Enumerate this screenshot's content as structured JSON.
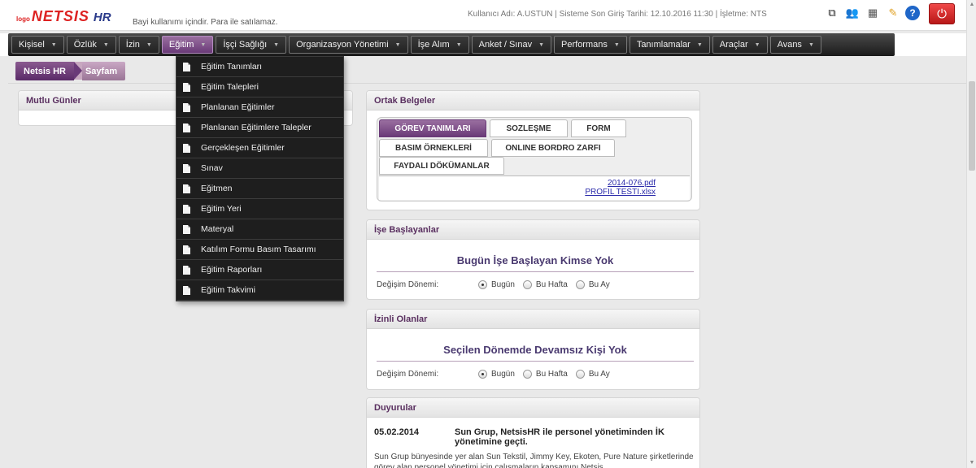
{
  "header": {
    "logo_small": "logo",
    "logo_main": "NETSIS",
    "logo_hr": "HR",
    "tagline": "Bayi kullanımı içindir. Para ile satılamaz.",
    "user_info": "Kullanıcı Adı: A.USTUN | Sisteme Son Giriş Tarihi: 12.10.2016 11:30 | İşletme: NTS",
    "tools": [
      {
        "icon": "external-link-icon",
        "glyph": "⧉"
      },
      {
        "icon": "users-icon",
        "glyph": "👥"
      },
      {
        "icon": "monitor-icon",
        "glyph": "▦"
      },
      {
        "icon": "pen-icon",
        "glyph": "✎"
      },
      {
        "icon": "help-icon",
        "glyph": "?"
      }
    ],
    "power_glyph": "⏻"
  },
  "menu": {
    "items": [
      {
        "label": "Kişisel"
      },
      {
        "label": "Özlük"
      },
      {
        "label": "İzin"
      },
      {
        "label": "Eğitim"
      },
      {
        "label": "İşçi Sağlığı"
      },
      {
        "label": "Organizasyon Yönetimi"
      },
      {
        "label": "İşe Alım"
      },
      {
        "label": "Anket / Sınav"
      },
      {
        "label": "Performans"
      },
      {
        "label": "Tanımlamalar"
      },
      {
        "label": "Araçlar"
      },
      {
        "label": "Avans"
      }
    ],
    "chevron": "▼",
    "accent": "#6a3a78"
  },
  "breadcrumb": {
    "root": "Netsis HR",
    "current": "Sayfam"
  },
  "dropdown": {
    "items": [
      "Eğitim Tanımları",
      "Eğitim Talepleri",
      "Planlanan Eğitimler",
      "Planlanan Eğitimlere Talepler",
      "Gerçekleşen Eğitimler",
      "Sınav",
      "Eğitmen",
      "Eğitim Yeri",
      "Materyal",
      "Katılım Formu Basım Tasarımı",
      "Eğitim Raporları",
      "Eğitim Takvimi"
    ]
  },
  "panels": {
    "mutlu": {
      "title": "Mutlu Günler"
    },
    "ortak": {
      "title": "Ortak Belgeler",
      "tabs": [
        "GÖREV TANIMLARI",
        "SOZLEŞME",
        "FORM",
        "BASIM ÖRNEKLERİ",
        "ONLINE BORDRO ZARFI",
        "FAYDALI DÖKÜMANLAR"
      ],
      "files": [
        "2014-076.pdf",
        "PROFIL TESTI.xlsx"
      ]
    },
    "ise": {
      "title": "İşe Başlayanlar",
      "message": "Bugün İşe Başlayan Kimse Yok",
      "period_label": "Değişim Dönemi:",
      "options": [
        "Bugün",
        "Bu Hafta",
        "Bu Ay"
      ],
      "selected": "Bugün"
    },
    "izinli": {
      "title": "İzinli Olanlar",
      "message": "Seçilen Dönemde Devamsız Kişi Yok",
      "period_label": "Değişim Dönemi:",
      "options": [
        "Bugün",
        "Bu Hafta",
        "Bu Ay"
      ],
      "selected": "Bugün"
    },
    "duyurular": {
      "title": "Duyurular",
      "date": "05.02.2014",
      "headline": "Sun Grup, NetsisHR ile personel yönetiminden İK yönetimine geçti.",
      "body": "Sun Grup bünyesinde yer alan Sun Tekstil, Jimmy Key, Ekoten, Pure Nature şirketlerinde görev alan personel yönetimi için çalışmaların kapsamını Netsis"
    }
  }
}
